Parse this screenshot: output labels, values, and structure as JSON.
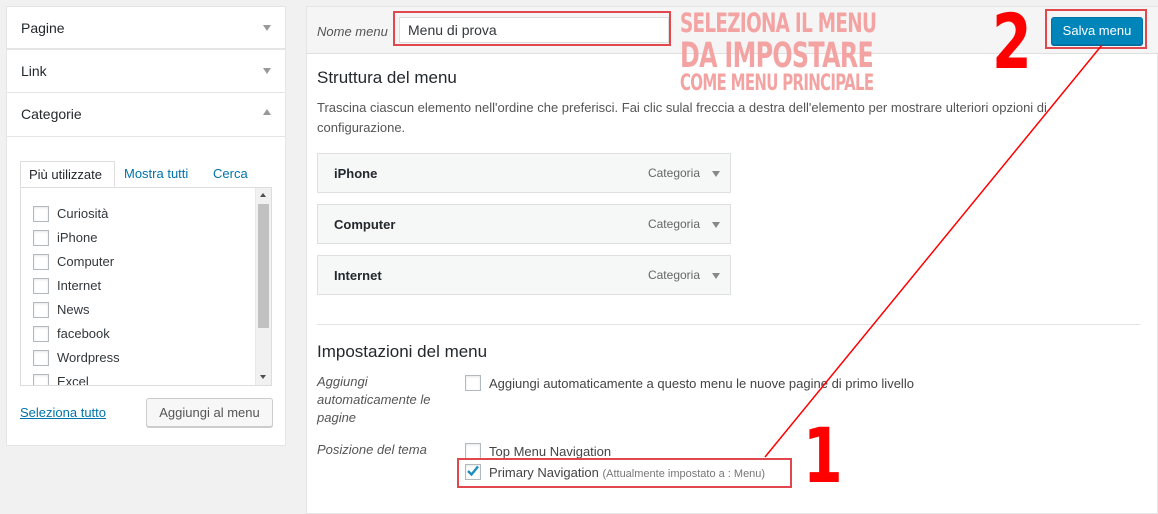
{
  "accordion": {
    "pagine": "Pagine",
    "link": "Link",
    "categorie": "Categorie"
  },
  "tabs": {
    "piu_utilizzate": "Più utilizzate",
    "mostra_tutti": "Mostra tutti",
    "cerca": "Cerca"
  },
  "categories": [
    "Curiosità",
    "iPhone",
    "Computer",
    "Internet",
    "News",
    "facebook",
    "Wordpress",
    "Excel"
  ],
  "select_all": "Seleziona tutto",
  "add_to_menu": "Aggiungi al menu",
  "header": {
    "menu_name_label": "Nome menu",
    "menu_name_value": "Menu di prova",
    "save_button": "Salva menu"
  },
  "structure": {
    "title": "Struttura del menu",
    "description": "Trascina ciascun elemento nell'ordine che preferisci. Fai clic sulal freccia a destra dell'elemento per mostrare ulteriori opzioni di configurazione.",
    "items": [
      {
        "name": "iPhone",
        "type": "Categoria"
      },
      {
        "name": "Computer",
        "type": "Categoria"
      },
      {
        "name": "Internet",
        "type": "Categoria"
      }
    ]
  },
  "settings": {
    "title": "Impostazioni del menu",
    "auto_add_label": "Aggiungi automaticamente le pagine",
    "auto_add_text": "Aggiungi automaticamente a questo menu le nuove pagine di primo livello",
    "theme_position_label": "Posizione del tema",
    "locations": [
      {
        "name": "Top Menu Navigation",
        "checked": false,
        "note": ""
      },
      {
        "name": "Primary Navigation",
        "checked": true,
        "note": "(Attualmente impostato a : Menu)"
      }
    ]
  },
  "annotations": {
    "line1": "SELEZIONA IL MENU",
    "line2": "DA IMPOSTARE",
    "line3": "COME MENU PRINCIPALE",
    "step1": "1",
    "step2": "2",
    "color": "#ff0000"
  }
}
